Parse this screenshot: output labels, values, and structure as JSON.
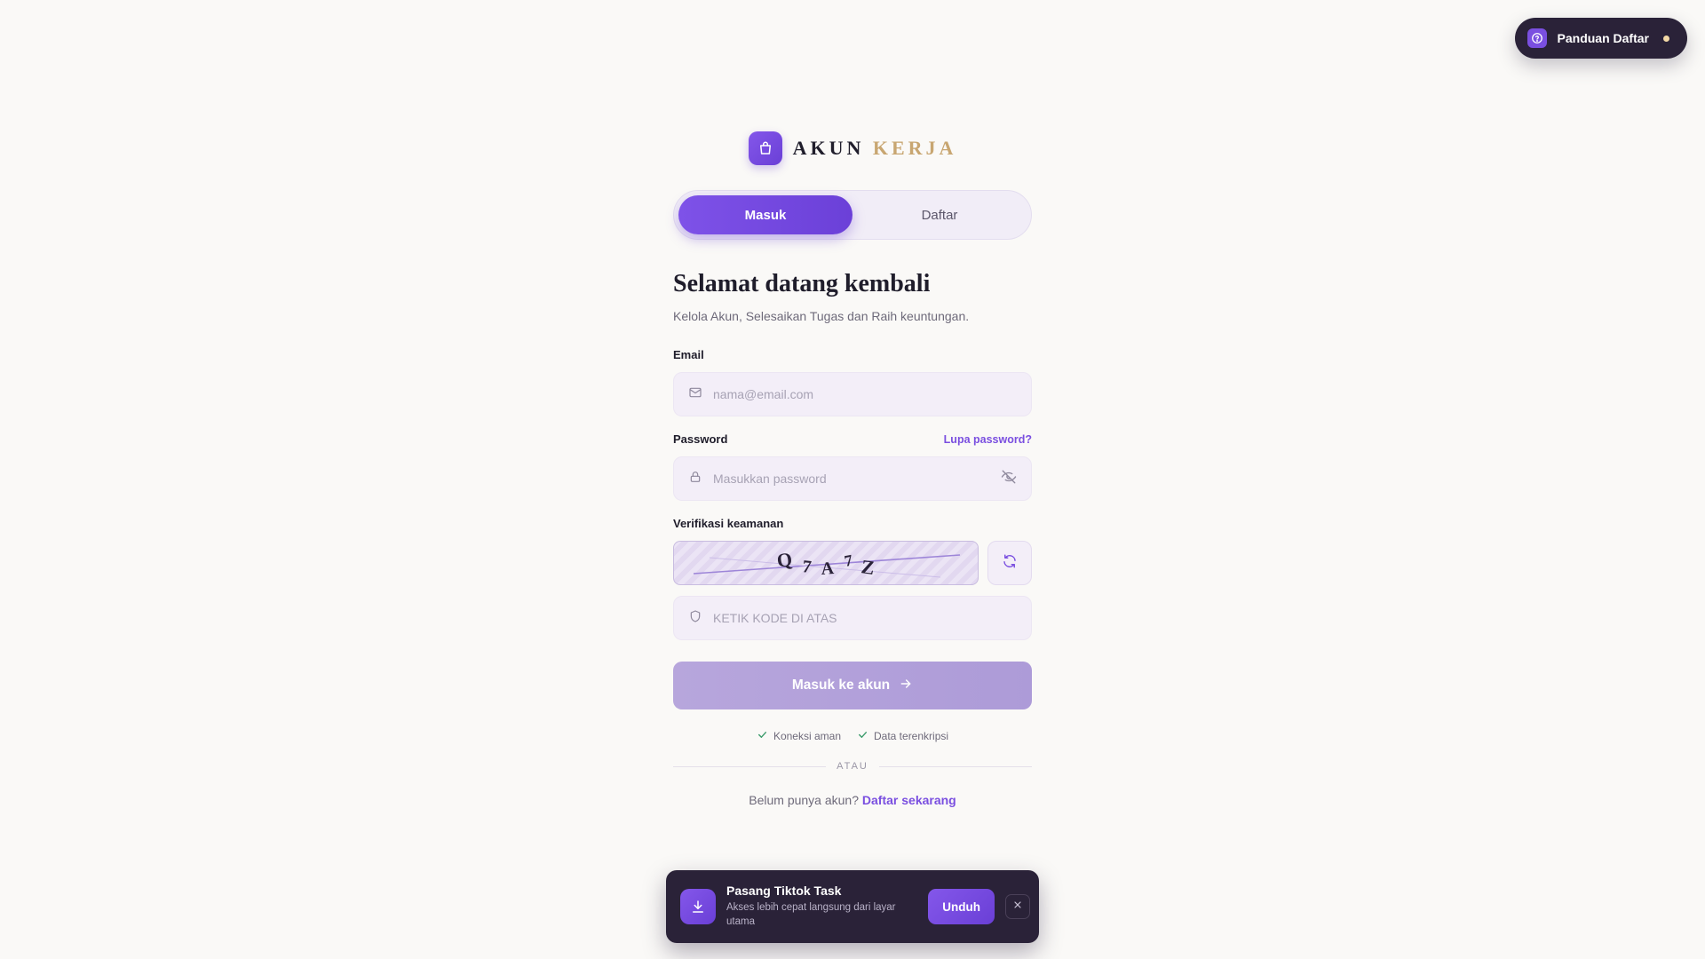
{
  "guide": {
    "label": "Panduan Daftar",
    "icon": "help-circle-icon"
  },
  "brand": {
    "part1": "AKUN",
    "part2": "KERJA",
    "icon": "shopping-bag-icon"
  },
  "tabs": [
    {
      "label": "Masuk",
      "active": true
    },
    {
      "label": "Daftar",
      "active": false
    }
  ],
  "heading": {
    "title": "Selamat datang kembali",
    "subtitle": "Kelola Akun, Selesaikan Tugas dan Raih keuntungan."
  },
  "email": {
    "label": "Email",
    "placeholder": "nama@email.com",
    "icon": "mail-icon"
  },
  "password": {
    "label": "Password",
    "placeholder": "Masukkan password",
    "forgot": "Lupa password?",
    "icon": "lock-icon",
    "toggle_icon": "eye-off-icon"
  },
  "captcha": {
    "label": "Verifikasi keamanan",
    "chars": [
      "Q",
      "7",
      "A",
      "7",
      "Z"
    ],
    "placeholder": "KETIK KODE DI ATAS",
    "refresh_icon": "refresh-icon",
    "field_icon": "shield-icon"
  },
  "submit": {
    "label": "Masuk ke akun",
    "icon": "arrow-right-icon"
  },
  "badges": [
    {
      "label": "Koneksi aman",
      "icon": "check-icon"
    },
    {
      "label": "Data terenkripsi",
      "icon": "check-icon"
    }
  ],
  "divider": {
    "label": "ATAU"
  },
  "signup": {
    "prompt": "Belum punya akun?",
    "link": "Daftar sekarang"
  },
  "install": {
    "title": "Pasang Tiktok Task",
    "description": "Akses lebih cepat langsung dari layar utama",
    "button": "Unduh",
    "icon": "download-icon",
    "close_icon": "close-icon"
  },
  "colors": {
    "accent": "#7a4fe0",
    "gold": "#c8a671",
    "dark": "#2a2238",
    "background": "#faf9f7"
  }
}
